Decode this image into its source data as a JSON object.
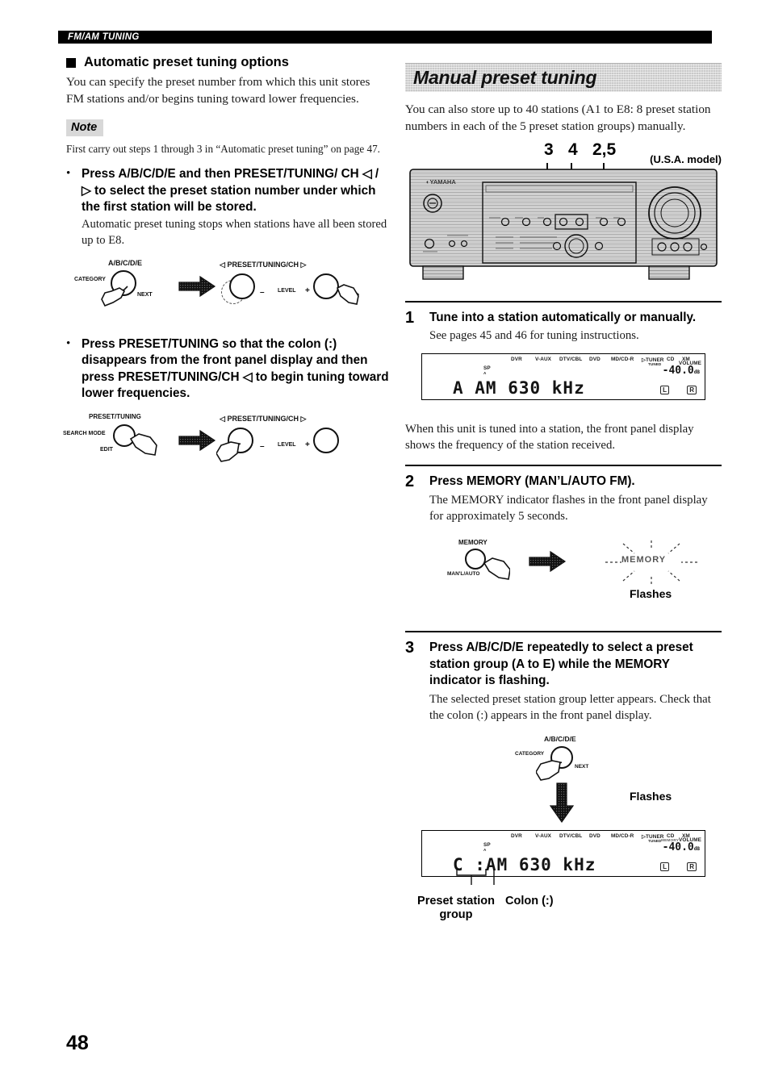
{
  "running_head": "FM/AM TUNING",
  "page_number": "48",
  "left_column": {
    "heading": "Automatic preset tuning options",
    "intro": "You can specify the preset number from which this unit stores FM stations and/or begins tuning toward lower frequencies.",
    "note_label": "Note",
    "note_text": "First carry out steps 1 through 3 in “Automatic preset tuning” on page 47.",
    "bullets": [
      {
        "strong": "Press A/B/C/D/E and then PRESET/TUNING/ CH ◁ / ▷ to select the preset station number under which the first station will be stored.",
        "sub": "Automatic preset tuning stops when stations have all been stored up to E8."
      },
      {
        "strong": "Press PRESET/TUNING so that the colon (:) disappears from the front panel display and then press PRESET/TUNING/CH ◁ to begin tuning toward lower frequencies.",
        "sub": ""
      }
    ],
    "diagram1": {
      "left_top_label": "A/B/C/D/E",
      "left_side_label": "CATEGORY",
      "left_right_label": "NEXT",
      "right_label": "PRESET/TUNING/CH",
      "right_left_arrow": "◁",
      "right_right_arrow": "▷",
      "minus": "–",
      "plus": "+",
      "level": "LEVEL"
    },
    "diagram2": {
      "left_top_label": "PRESET/TUNING",
      "left_side_label": "SEARCH MODE",
      "left_bottom_label": "EDIT",
      "right_label": "PRESET/TUNING/CH",
      "right_left_arrow": "◁",
      "right_right_arrow": "▷",
      "minus": "–",
      "plus": "+",
      "level": "LEVEL"
    }
  },
  "right_column": {
    "banner_title": "Manual preset tuning",
    "intro": "You can also store up to 40 stations (A1 to E8: 8 preset station numbers in each of the 5 preset station groups) manually.",
    "receiver": {
      "callouts": [
        "3",
        "4",
        "2,5"
      ],
      "model_note": "(U.S.A. model)",
      "brand": "YAMAHA"
    },
    "steps": [
      {
        "num": "1",
        "title": "Tune into a station automatically or manually.",
        "body": "See pages 45 and 46 for tuning instructions.",
        "after": "When this unit is tuned into a station, the front panel display shows the frequency of the station received."
      },
      {
        "num": "2",
        "title": "Press MEMORY (MAN’L/AUTO FM).",
        "body": "The MEMORY indicator flashes in the front panel display for approximately 5 seconds.",
        "after": ""
      },
      {
        "num": "3",
        "title": "Press A/B/C/D/E repeatedly to select a preset station group (A to E) while the MEMORY indicator is flashing.",
        "body": "The selected preset station group letter appears. Check that the colon (:) appears in the front panel display.",
        "after": ""
      }
    ],
    "memory_diagram": {
      "button_label": "MEMORY",
      "button_sub": "MAN'L/AUTO",
      "indicator_text": "MEMORY",
      "caption": "Flashes"
    },
    "group_diagram": {
      "top_label": "A/B/C/D/E",
      "side_label": "CATEGORY",
      "right_label": "NEXT",
      "caption": "Flashes"
    },
    "lcd_display_1": {
      "sources": [
        "DVR",
        "V-AUX",
        "DTV/CBL",
        "DVD",
        "MD/CD-R",
        "TUNER",
        "CD",
        "XM"
      ],
      "tuner_sub": "TUNED",
      "sp_label": "SP",
      "sp_sub": "A",
      "volume_label": "VOLUME",
      "volume_value": "-40.0",
      "volume_unit": "dB",
      "main_text": "A   AM    630  kHz",
      "left_channel": "L",
      "right_channel": "R"
    },
    "lcd_display_2": {
      "sources": [
        "DVR",
        "V-AUX",
        "DTV/CBL",
        "DVD",
        "MD/CD-R",
        "TUNER",
        "CD",
        "XM"
      ],
      "tuner_sub": "TUNED",
      "memory_indicator": "MEMORY",
      "sp_label": "SP",
      "sp_sub": "A",
      "volume_label": "VOLUME",
      "volume_value": "-40.0",
      "volume_unit": "dB",
      "main_text": "C  :AM   630  kHz",
      "left_channel": "L",
      "right_channel": "R",
      "caption_group": "Preset station group",
      "caption_colon": "Colon (:)"
    }
  }
}
